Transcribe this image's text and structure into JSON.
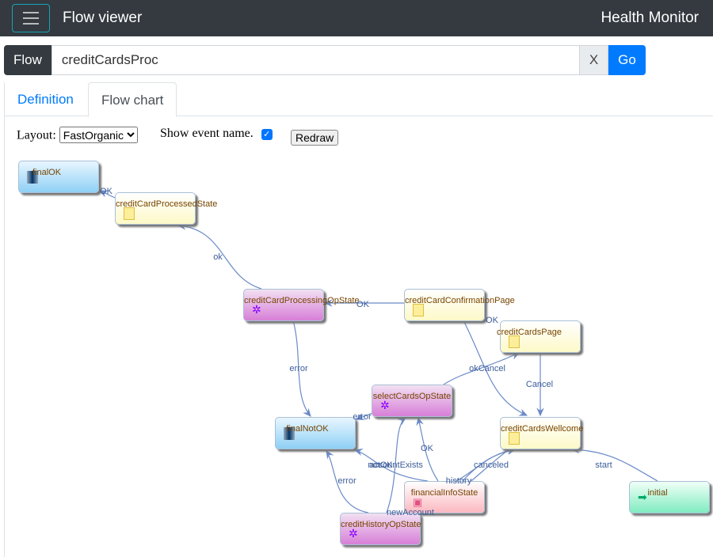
{
  "navbar": {
    "title": "Flow viewer",
    "right": "Health Monitor",
    "menu_icon": "hamburger-icon"
  },
  "search": {
    "prefix": "Flow",
    "value": "creditCardsProc",
    "clear": "X",
    "go": "Go"
  },
  "tabs": [
    {
      "label": "Definition",
      "active": false
    },
    {
      "label": "Flow chart",
      "active": true
    }
  ],
  "controls": {
    "layout_label": "Layout:",
    "layout_value": "FastOrganic",
    "show_event_label": "Show event name.",
    "show_event_checked": true,
    "redraw": "Redraw"
  },
  "nodes": {
    "finalOK": "finalOK",
    "creditCardProcessedState": "creditCardProcessedState",
    "creditCardProcessingOpState": "creditCardProcessingOpState",
    "creditCardConfirmationPage": "creditCardConfirmationPage",
    "creditCardsPage": "creditCardsPage",
    "selectCardsOpState": "selectCardsOpState",
    "finalNotOK": "finalNotOK",
    "creditCardsWellcome": "creditCardsWellcome",
    "financialInfoState": "financialInfoState",
    "initial": "initial",
    "creditHistoryOpState": "creditHistoryOpState"
  },
  "edges": {
    "e1": "OK",
    "e2": "ok",
    "e3": "OK",
    "e4": "OK",
    "e5": "error",
    "e6": "okCancel",
    "e7": "Cancel",
    "e8": "error",
    "e9": "notOK",
    "e9b": "accountExists",
    "e10": "OK",
    "e11": "canceled",
    "e12": "history",
    "e13": "error",
    "e14": "newAccount",
    "e15": "start"
  },
  "colors": {
    "navbar": "#343a40",
    "primary": "#007bff",
    "edge": "#6a8ac8",
    "node_text": "#774400"
  }
}
